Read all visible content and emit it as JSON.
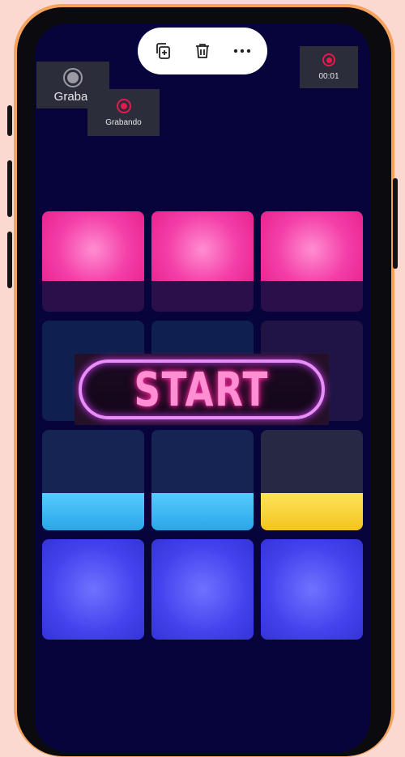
{
  "toolbar": {
    "items": [
      {
        "icon": "duplicate-icon"
      },
      {
        "icon": "trash-icon"
      },
      {
        "icon": "more-options-icon"
      }
    ]
  },
  "recorder": {
    "grabar_label": "Grabar",
    "grabando_label": "Grabando",
    "timer": "00:01"
  },
  "start": {
    "label": "START"
  },
  "colors": {
    "pink": "#f43ea8",
    "cyan": "#3db8f0",
    "yellow": "#f4d43a",
    "blue": "#4343ee",
    "background": "#06043a",
    "neon_border": "#e78ff7"
  }
}
